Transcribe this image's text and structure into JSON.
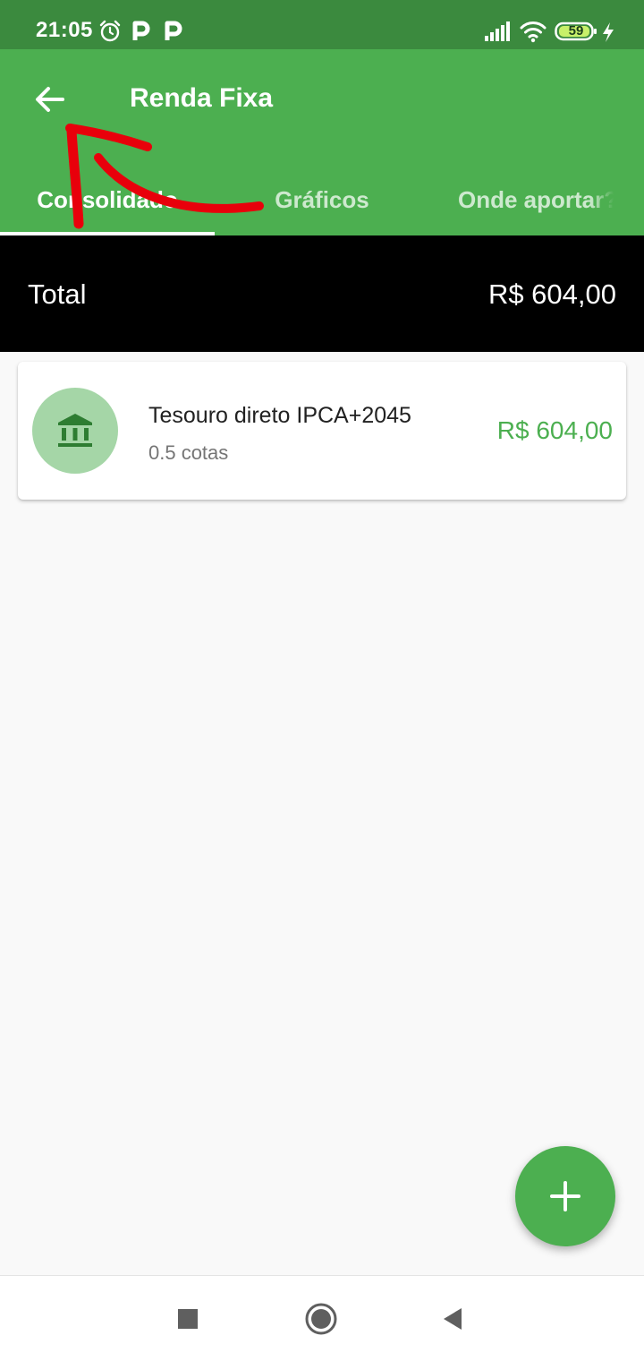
{
  "status_bar": {
    "time": "21:05",
    "battery": "59",
    "icons": [
      "alarm-icon",
      "parking-icon",
      "parking-icon",
      "signal-icon",
      "wifi-icon",
      "battery-icon",
      "charging-icon"
    ]
  },
  "app_bar": {
    "title": "Renda Fixa",
    "back_icon": "arrow-back-icon",
    "tabs": [
      {
        "label": "Consolidado",
        "selected": true
      },
      {
        "label": "Gráficos",
        "selected": false
      },
      {
        "label": "Onde aportar?",
        "selected": false
      }
    ]
  },
  "total": {
    "label": "Total",
    "value": "R$ 604,00"
  },
  "holdings": [
    {
      "icon": "bank-icon",
      "name": "Tesouro direto IPCA+2045",
      "quantity": "0.5 cotas",
      "value": "R$ 604,00"
    }
  ],
  "fab": {
    "icon": "plus-icon"
  },
  "nav_bar": {
    "icons": [
      "recents-icon",
      "home-icon",
      "back-triangle-icon"
    ]
  },
  "colors": {
    "primary": "#4caf50",
    "primary_dark": "#3b8a3e",
    "avatar_bg": "#a5d6a7",
    "annotation": "#e8000b"
  }
}
